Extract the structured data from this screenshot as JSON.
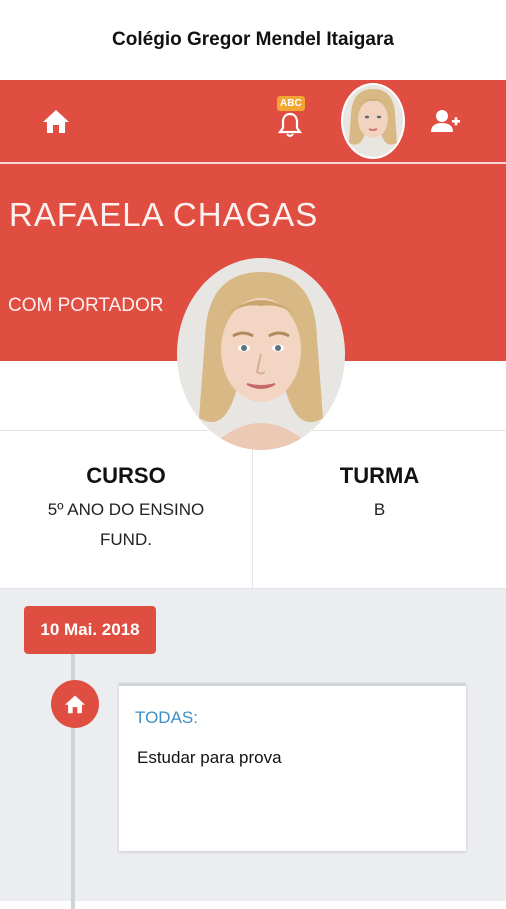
{
  "app": {
    "title": "Colégio Gregor Mendel Itaigara"
  },
  "toolbar": {
    "home_icon": "home-icon",
    "abc_badge": "ABC",
    "bell_icon": "bell-icon",
    "avatar": "student-avatar",
    "add_user_icon": "add-user-icon"
  },
  "student": {
    "name": "RAFAELA CHAGAS",
    "status": "COM PORTADOR"
  },
  "info": {
    "course_label": "CURSO",
    "course_value": "5º ANO DO ENSINO FUND.",
    "class_label": "TURMA",
    "class_value": "B"
  },
  "feed": {
    "date": "10 Mai. 2018",
    "items": [
      {
        "icon": "home-icon",
        "target": "TODAS:",
        "text": "Estudar para prova"
      }
    ]
  },
  "colors": {
    "primary": "#e04e42",
    "accent_blue": "#3d8fc4",
    "badge": "#f2a531"
  }
}
